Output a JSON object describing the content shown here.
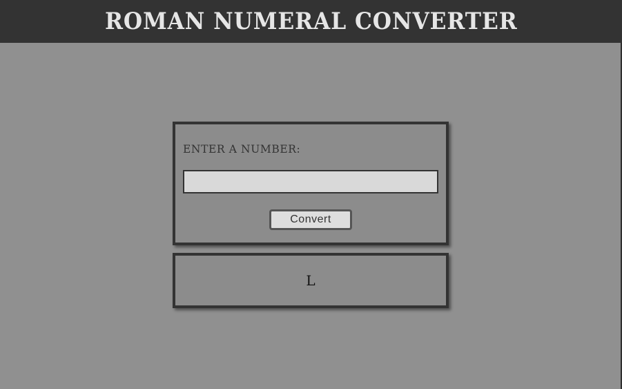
{
  "header": {
    "title": "ROMAN NUMERAL CONVERTER"
  },
  "form": {
    "label": "ENTER A NUMBER:",
    "input_value": "",
    "input_placeholder": "",
    "button_label": "Convert"
  },
  "output": {
    "result": "L"
  },
  "colors": {
    "background": "#909090",
    "header_bg": "#333333",
    "header_text": "#e6e6e6",
    "border": "#333333",
    "input_bg": "#d9d9d9"
  }
}
